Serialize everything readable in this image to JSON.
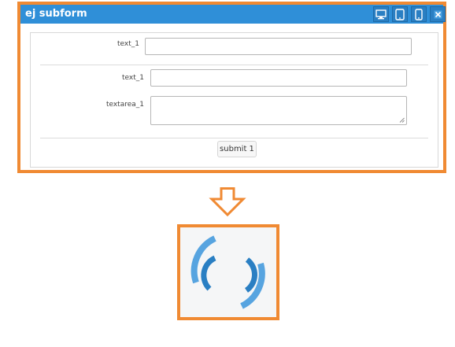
{
  "window": {
    "title": "ej subform",
    "title_icons": [
      "desktop-icon",
      "tablet-icon",
      "phone-icon",
      "close-icon"
    ]
  },
  "form": {
    "top_field": {
      "label": "text_1",
      "value": ""
    },
    "subform_fields": [
      {
        "label": "text_1",
        "value": ""
      },
      {
        "label": "textarea_1",
        "value": ""
      }
    ],
    "submit_label": "submit 1"
  },
  "preview": {
    "icon": "loading-spinner-icon"
  },
  "colors": {
    "frame_border": "#f08a33",
    "titlebar": "#2f8fd8",
    "spinner": "#3b95dc"
  }
}
